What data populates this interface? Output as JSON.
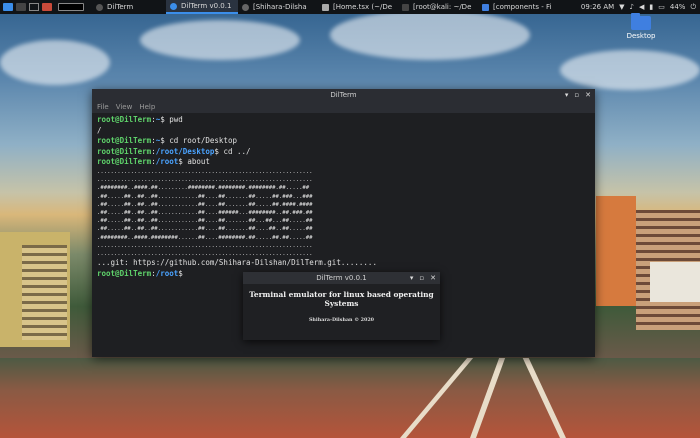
{
  "panel": {
    "tasks": [
      {
        "label": "DilTerm",
        "icon": "kali-icon",
        "active": false
      },
      {
        "label": "DilTerm v0.0.1",
        "icon": "dilterm-icon",
        "active": true
      },
      {
        "label": "[Shihara-Dilsha",
        "icon": "browser-icon",
        "active": false
      },
      {
        "label": "[Home.tsx (~/De",
        "icon": "editor-icon",
        "active": false
      },
      {
        "label": "[root@kali: ~/De",
        "icon": "terminal-icon",
        "active": false
      },
      {
        "label": "[components - Fi",
        "icon": "folder-icon",
        "active": false
      }
    ],
    "clock": "09:26 AM",
    "battery": "44%"
  },
  "desktop": {
    "icon_label": "Desktop"
  },
  "terminal": {
    "title": "DilTerm",
    "menu": [
      "File",
      "View",
      "Help"
    ],
    "lines": [
      {
        "user": "root@DilTerm",
        "path": "~",
        "cmd": "pwd"
      },
      {
        "output": "/"
      },
      {
        "user": "root@DilTerm",
        "path": "~",
        "cmd": "cd root/Desktop"
      },
      {
        "user": "root@DilTerm",
        "path": "/root/Desktop",
        "cmd": "cd ../"
      },
      {
        "user": "root@DilTerm",
        "path": "/root",
        "cmd": "about"
      }
    ],
    "art": [
      "................................................................",
      "................................................................",
      ".########..####.##.........########.########.########.##.....##",
      ".##.....##..##..##............##....##.......##.....##.###...###",
      ".##.....##..##..##............##....##.......##.....##.####.####",
      ".##.....##..##..##............##....######...########..##.###.##",
      ".##.....##..##..##............##....##.......##...##...##.....##",
      ".##.....##..##..##............##....##.......##....##..##.....##",
      ".########..####.########......##....########.##.....##.##.....##",
      "................................................................",
      "................................................................"
    ],
    "git_line": "...git: https://github.com/Shihara-Dilshan/DilTerm.git........",
    "final_prompt": {
      "user": "root@DilTerm",
      "path": "/root",
      "cmd": ""
    }
  },
  "about_dialog": {
    "title": "DilTerm v0.0.1",
    "heading": "Terminal emulator for linux based operating Systems",
    "credit": "Shihara-Dilshan © 2020"
  }
}
